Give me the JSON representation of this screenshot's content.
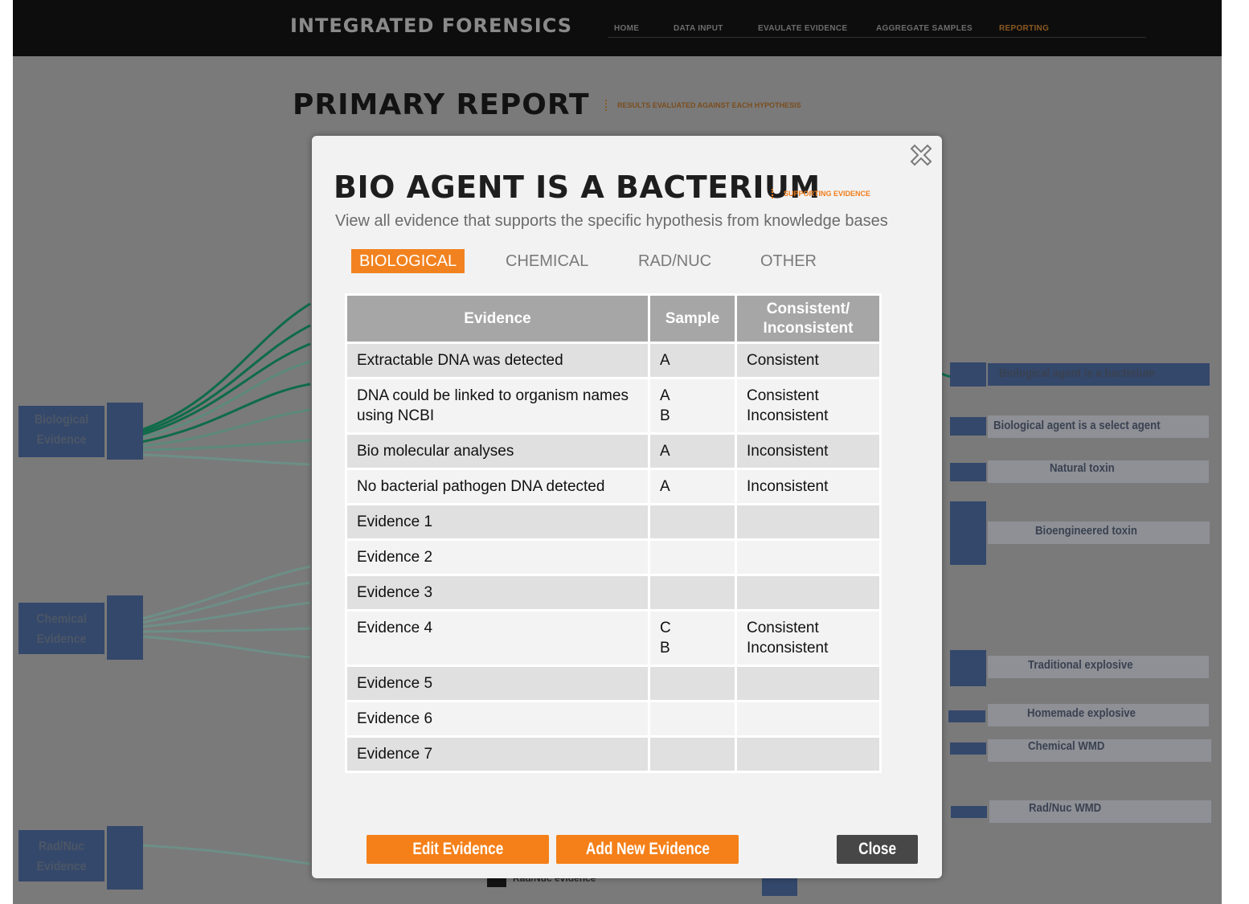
{
  "app": {
    "logo": "INTEGRATED FORENSICS",
    "nav": [
      "HOME",
      "DATA INPUT",
      "EVAULATE EVIDENCE",
      "AGGREGATE SAMPLES",
      "REPORTING"
    ],
    "active_nav": "REPORTING"
  },
  "report": {
    "title": "PRIMARY REPORT",
    "subtitle": "RESULTS EVALUATED AGAINST EACH HYPOTHESIS"
  },
  "background": {
    "left_groups": [
      {
        "line1": "Biological",
        "line2": "Evidence"
      },
      {
        "line1": "Chemical",
        "line2": "Evidence"
      },
      {
        "line1": "Rad/Nuc",
        "line2": "Evidence"
      }
    ],
    "hypotheses": [
      "Biological agent is a bacterium",
      "Biological agent is a select agent",
      "Natural toxin",
      "Bioengineered toxin",
      "Traditional explosive",
      "Homemade explosive",
      "Chemical WMD",
      "Rad/Nuc WMD"
    ],
    "bottom_legend": "Rad/Nuc evidence",
    "colors": {
      "box": "#34486b",
      "curve_primary": "#0e6b4a",
      "curve_secondary": "#5c8a7c"
    }
  },
  "modal": {
    "title": "BIO AGENT IS A BACTERIUM",
    "badge": "SUPPORTING EVIDENCE",
    "description": "View all evidence that supports the specific hypothesis from knowledge bases",
    "tabs": [
      "BIOLOGICAL",
      "CHEMICAL",
      "RAD/NUC",
      "OTHER"
    ],
    "active_tab": "BIOLOGICAL",
    "columns": {
      "evidence": "Evidence",
      "sample": "Sample",
      "status_line1": "Consistent/",
      "status_line2": "Inconsistent"
    },
    "rows": [
      {
        "evidence": "Extractable DNA was detected",
        "samples": [
          "A"
        ],
        "statuses": [
          "Consistent"
        ]
      },
      {
        "evidence": "DNA could be linked to organism names using NCBI",
        "samples": [
          "A",
          "B"
        ],
        "statuses": [
          "Consistent",
          "Inconsistent"
        ]
      },
      {
        "evidence": "Bio molecular analyses",
        "samples": [
          "A"
        ],
        "statuses": [
          "Inconsistent"
        ]
      },
      {
        "evidence": "No bacterial pathogen DNA detected",
        "samples": [
          "A"
        ],
        "statuses": [
          "Inconsistent"
        ]
      },
      {
        "evidence": "Evidence 1",
        "samples": [],
        "statuses": []
      },
      {
        "evidence": "Evidence 2",
        "samples": [],
        "statuses": []
      },
      {
        "evidence": "Evidence 3",
        "samples": [],
        "statuses": []
      },
      {
        "evidence": "Evidence 4",
        "samples": [
          "C",
          "B"
        ],
        "statuses": [
          "Consistent",
          "Inconsistent"
        ]
      },
      {
        "evidence": "Evidence 5",
        "samples": [],
        "statuses": []
      },
      {
        "evidence": "Evidence 6",
        "samples": [],
        "statuses": []
      },
      {
        "evidence": "Evidence 7",
        "samples": [],
        "statuses": []
      }
    ],
    "buttons": {
      "edit": "Edit Evidence",
      "add": "Add New Evidence",
      "close": "Close"
    },
    "accent_color": "#f2821f"
  }
}
